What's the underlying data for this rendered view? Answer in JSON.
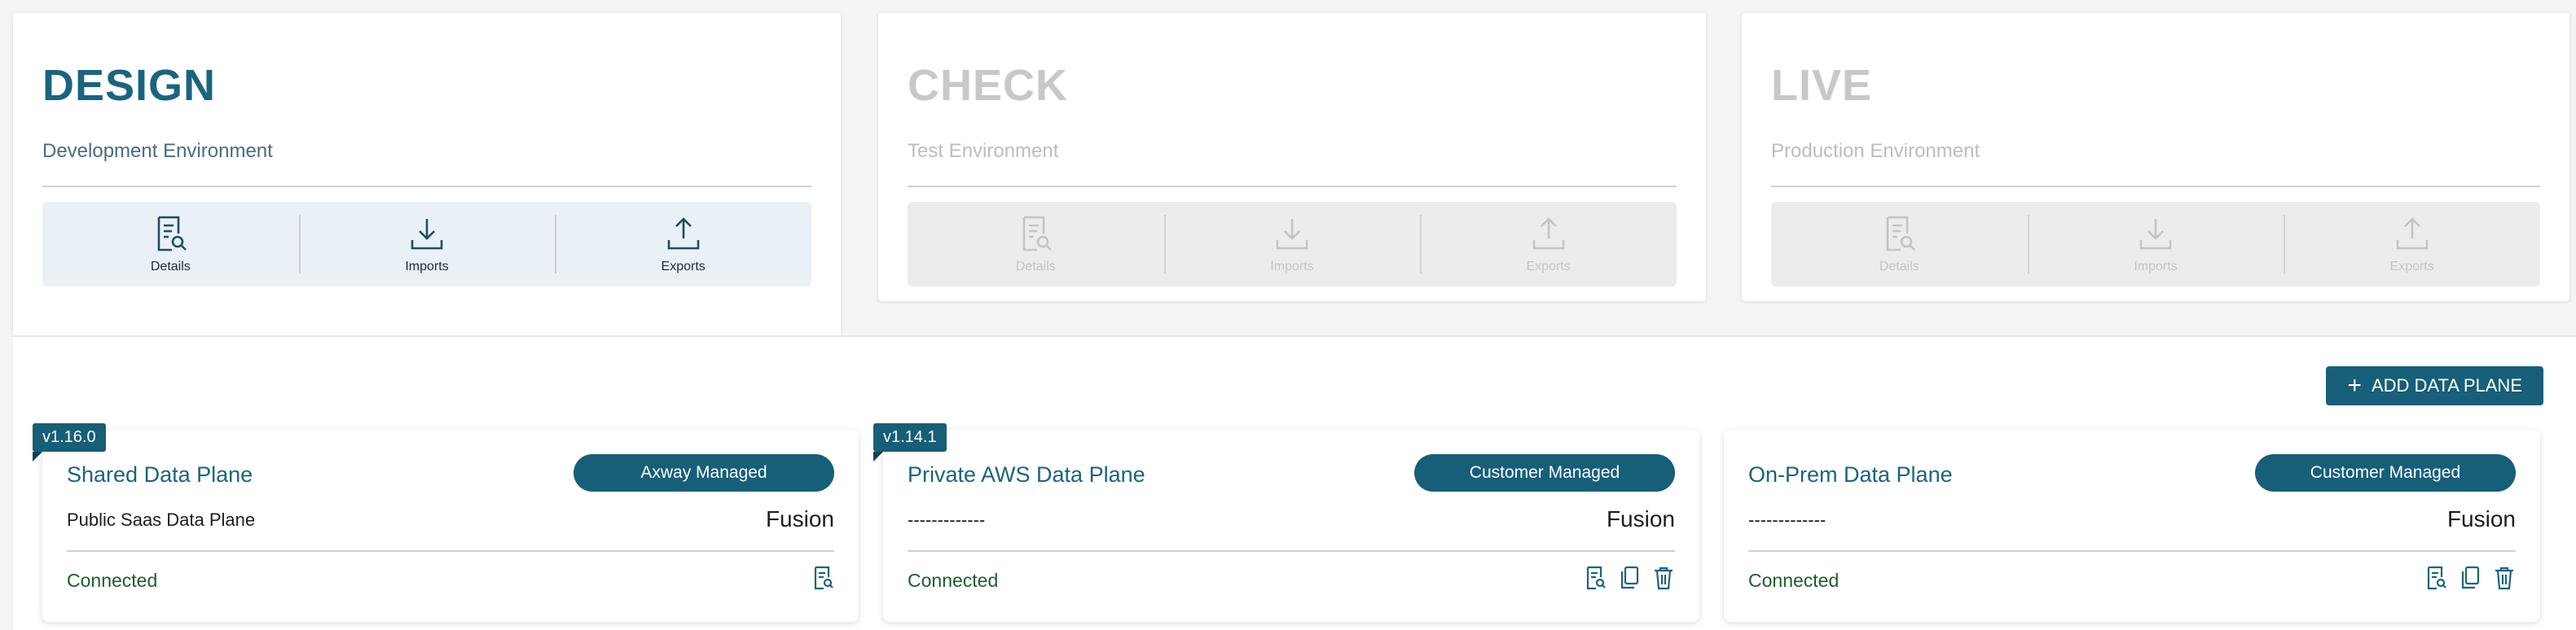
{
  "environments": [
    {
      "title": "DESIGN",
      "subtitle": "Development Environment",
      "active": true,
      "actions": {
        "details": "Details",
        "imports": "Imports",
        "exports": "Exports"
      }
    },
    {
      "title": "CHECK",
      "subtitle": "Test Environment",
      "active": false,
      "actions": {
        "details": "Details",
        "imports": "Imports",
        "exports": "Exports"
      }
    },
    {
      "title": "LIVE",
      "subtitle": "Production Environment",
      "active": false,
      "actions": {
        "details": "Details",
        "imports": "Imports",
        "exports": "Exports"
      }
    }
  ],
  "toolbar": {
    "add_label": "ADD DATA PLANE"
  },
  "data_planes": [
    {
      "version": "v1.16.0",
      "name": "Shared Data Plane",
      "managed": "Axway Managed",
      "description": "Public Saas Data Plane",
      "engine": "Fusion",
      "status": "Connected"
    },
    {
      "version": "v1.14.1",
      "name": "Private AWS Data Plane",
      "managed": "Customer Managed",
      "description": "-------------",
      "engine": "Fusion",
      "status": "Connected"
    },
    {
      "version": "",
      "name": "On-Prem Data Plane",
      "managed": "Customer Managed",
      "description": "-------------",
      "engine": "Fusion",
      "status": "Connected"
    }
  ],
  "colors": {
    "primary": "#175e79",
    "title_blue": "#1a6480",
    "connected_green": "#1e5c2e"
  }
}
